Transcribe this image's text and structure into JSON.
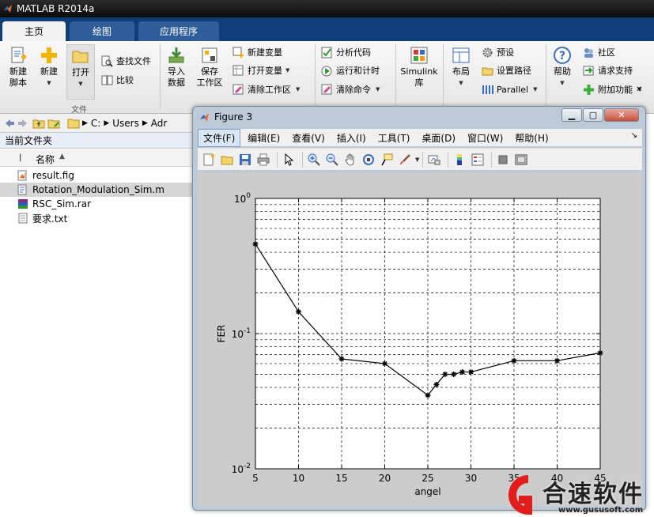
{
  "app": {
    "title": "MATLAB R2014a"
  },
  "tabs": [
    {
      "label": "主页",
      "active": true
    },
    {
      "label": "绘图",
      "active": false
    },
    {
      "label": "应用程序",
      "active": false
    }
  ],
  "ribbon": {
    "file_group": {
      "label": "文件",
      "new_script": "新建\n脚本",
      "new": "新建",
      "open": "打开",
      "find_files": "查找文件",
      "compare": "比较"
    },
    "variable_group": {
      "import_data": "导入\n数据",
      "save_workspace": "保存\n工作区",
      "new_variable": "新建变量",
      "open_variable": "打开变量",
      "clear_workspace": "清除工作区"
    },
    "code_group": {
      "analyze_code": "分析代码",
      "run_and_time": "运行和计时",
      "clear_commands": "清除命令"
    },
    "simulink": {
      "label": "Simulink\n库"
    },
    "environment_group": {
      "layout": "布局",
      "preferences": "预设",
      "set_path": "设置路径",
      "parallel": "Parallel"
    },
    "resources_group": {
      "help": "帮助",
      "community": "社区",
      "request_support": "请求支持",
      "add_ons": "附加功能"
    }
  },
  "address_bar": {
    "crumbs": [
      "C:",
      "Users",
      "Adr"
    ]
  },
  "folder_panel": {
    "title": "当前文件夹",
    "column_name": "名称",
    "files": [
      {
        "name": "result.fig",
        "icon": "fig-file-icon",
        "selected": false
      },
      {
        "name": "Rotation_Modulation_Sim.m",
        "icon": "m-file-icon",
        "selected": true
      },
      {
        "name": "RSC_Sim.rar",
        "icon": "rar-file-icon",
        "selected": false
      },
      {
        "name": "要求.txt",
        "icon": "txt-file-icon",
        "selected": false
      }
    ]
  },
  "figure_window": {
    "title": "Figure 3",
    "menu": [
      {
        "label": "文件(F)",
        "active": true
      },
      {
        "label": "编辑(E)",
        "active": false
      },
      {
        "label": "查看(V)",
        "active": false
      },
      {
        "label": "插入(I)",
        "active": false
      },
      {
        "label": "工具(T)",
        "active": false
      },
      {
        "label": "桌面(D)",
        "active": false
      },
      {
        "label": "窗口(W)",
        "active": false
      },
      {
        "label": "帮助(H)",
        "active": false
      }
    ],
    "toolbar_icons": [
      "new-figure-icon",
      "open-file-icon",
      "save-icon",
      "print-icon",
      "pointer-icon",
      "zoom-in-icon",
      "zoom-out-icon",
      "pan-icon",
      "rotate-3d-icon",
      "data-cursor-icon",
      "brush-icon",
      "link-plot-icon",
      "colorbar-icon",
      "legend-icon",
      "hide-plot-tools-icon",
      "show-plot-tools-icon"
    ]
  },
  "chart_data": {
    "type": "line",
    "xlabel": "angel",
    "ylabel": "FER",
    "xlim": [
      5,
      45
    ],
    "ylim": [
      0.01,
      1
    ],
    "yscale": "log",
    "grid": true,
    "marker": "star",
    "x_ticks": [
      "5",
      "10",
      "15",
      "20",
      "25",
      "30",
      "35",
      "40",
      "45"
    ],
    "y_ticks": [
      {
        "base": "10",
        "exp": "0",
        "value": 1
      },
      {
        "base": "10",
        "exp": "-1",
        "value": 0.1
      },
      {
        "base": "10",
        "exp": "-2",
        "value": 0.01
      }
    ],
    "series": [
      {
        "x": [
          5,
          10,
          15,
          20,
          25,
          26,
          27,
          28,
          29,
          30,
          35,
          40,
          45
        ],
        "y": [
          0.46,
          0.145,
          0.065,
          0.06,
          0.035,
          0.042,
          0.05,
          0.05,
          0.052,
          0.052,
          0.063,
          0.063,
          0.072
        ]
      }
    ]
  },
  "watermark": {
    "text": "合速软件",
    "url": "www.gususoft.com"
  },
  "colors": {
    "tab_strip": "#0e3e79",
    "ribbon_bg": "#f2f2f2",
    "selected_row": "#d6d6d6",
    "figure_bg": "#cccccc",
    "plot_line": "#000000",
    "watermark_red": "#e21b1b"
  }
}
